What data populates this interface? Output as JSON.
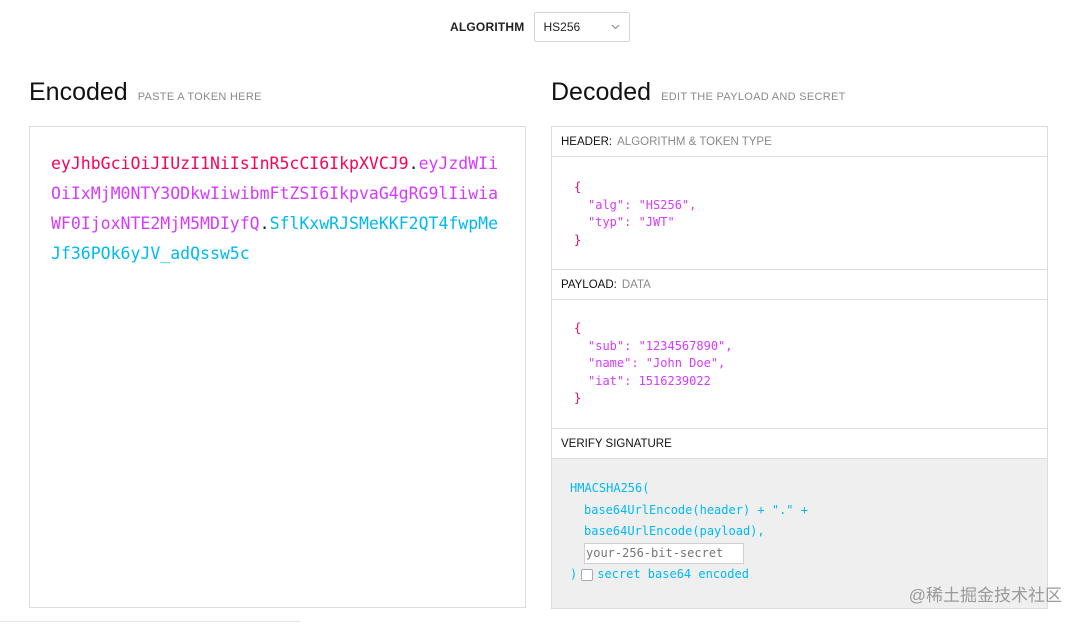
{
  "algorithm": {
    "label": "ALGORITHM",
    "selected": "HS256"
  },
  "encoded": {
    "title": "Encoded",
    "subtitle": "PASTE A TOKEN HERE",
    "header_part": "eyJhbGciOiJIUzI1NiIsInR5cCI6IkpXVCJ9",
    "payload_part": "eyJzdWIiOiIxMjM0NTY3ODkwIiwibmFtZSI6IkpvaG4gRG9lIiwiaWF0IjoxNTE2MjM5MDIyfQ",
    "signature_part": "SflKxwRJSMeKKF2QT4fwpMeJf36POk6yJV_adQssw5c",
    "dot": "."
  },
  "decoded": {
    "title": "Decoded",
    "subtitle": "EDIT THE PAYLOAD AND SECRET",
    "header": {
      "label": "HEADER:",
      "sublabel": "ALGORITHM & TOKEN TYPE",
      "open": "{",
      "lines": [
        "\"alg\": \"HS256\",",
        "\"typ\": \"JWT\""
      ],
      "close": "}"
    },
    "payload": {
      "label": "PAYLOAD:",
      "sublabel": "DATA",
      "open": "{",
      "lines": [
        "\"sub\": \"1234567890\",",
        "\"name\": \"John Doe\",",
        "\"iat\": 1516239022"
      ],
      "close": "}"
    },
    "verify": {
      "label": "VERIFY SIGNATURE",
      "fn_open": "HMACSHA256(",
      "line1": "base64UrlEncode(header) + \".\" +",
      "line2": "base64UrlEncode(payload),",
      "secret_placeholder": "your-256-bit-secret",
      "close_paren": ")",
      "checkbox_label": "secret base64 encoded"
    }
  },
  "watermark": "@稀土掘金技术社区"
}
